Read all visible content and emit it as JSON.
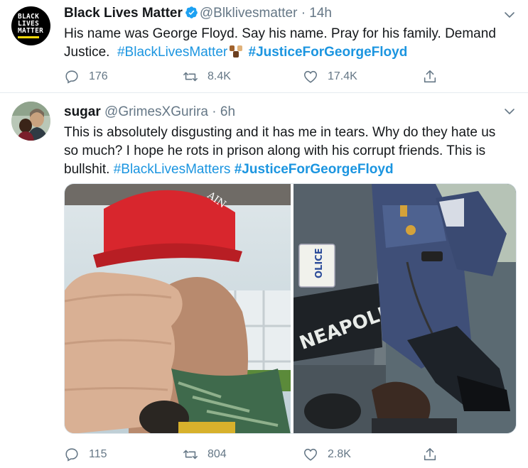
{
  "tweets": [
    {
      "display_name": "Black Lives Matter",
      "handle": "@Blklivesmatter",
      "separator": "·",
      "time": "14h",
      "avatar_text": [
        "BLACK",
        "LIVES",
        "MATTER"
      ],
      "text_plain": "His name was George Floyd. Say his name. Pray for his family. Demand Justice.",
      "hashtag_1": "#BlackLivesMatter",
      "hashtag_2": "#JusticeForGeorgeFloyd",
      "replies": "176",
      "retweets": "8.4K",
      "likes": "17.4K"
    },
    {
      "display_name": "sugar",
      "handle": "@GrimesXGurira",
      "separator": "·",
      "time": "6h",
      "text_plain": "This is absolutely disgusting and it has me in tears. Why do they hate us so much? I hope he rots in prison along with his corrupt friends. This is bullshit.",
      "hashtag_1": "#BlackLivesMatters",
      "hashtag_2": "#JusticeForGeorgeFloyd",
      "image_right_text_1": "OLICE",
      "image_right_text_2": "NEAPOLIS",
      "image_left_cap_text": "AIN",
      "replies": "115",
      "retweets": "804",
      "likes": "2.8K"
    }
  ],
  "colors": {
    "accent": "#1b95e0",
    "muted": "#657786",
    "text": "#14171a",
    "divider": "#e6ecf0"
  },
  "icons": [
    "verified-badge-icon",
    "chevron-down-icon",
    "reply-icon",
    "retweet-icon",
    "like-icon",
    "share-icon",
    "raised-fists-emoji"
  ]
}
